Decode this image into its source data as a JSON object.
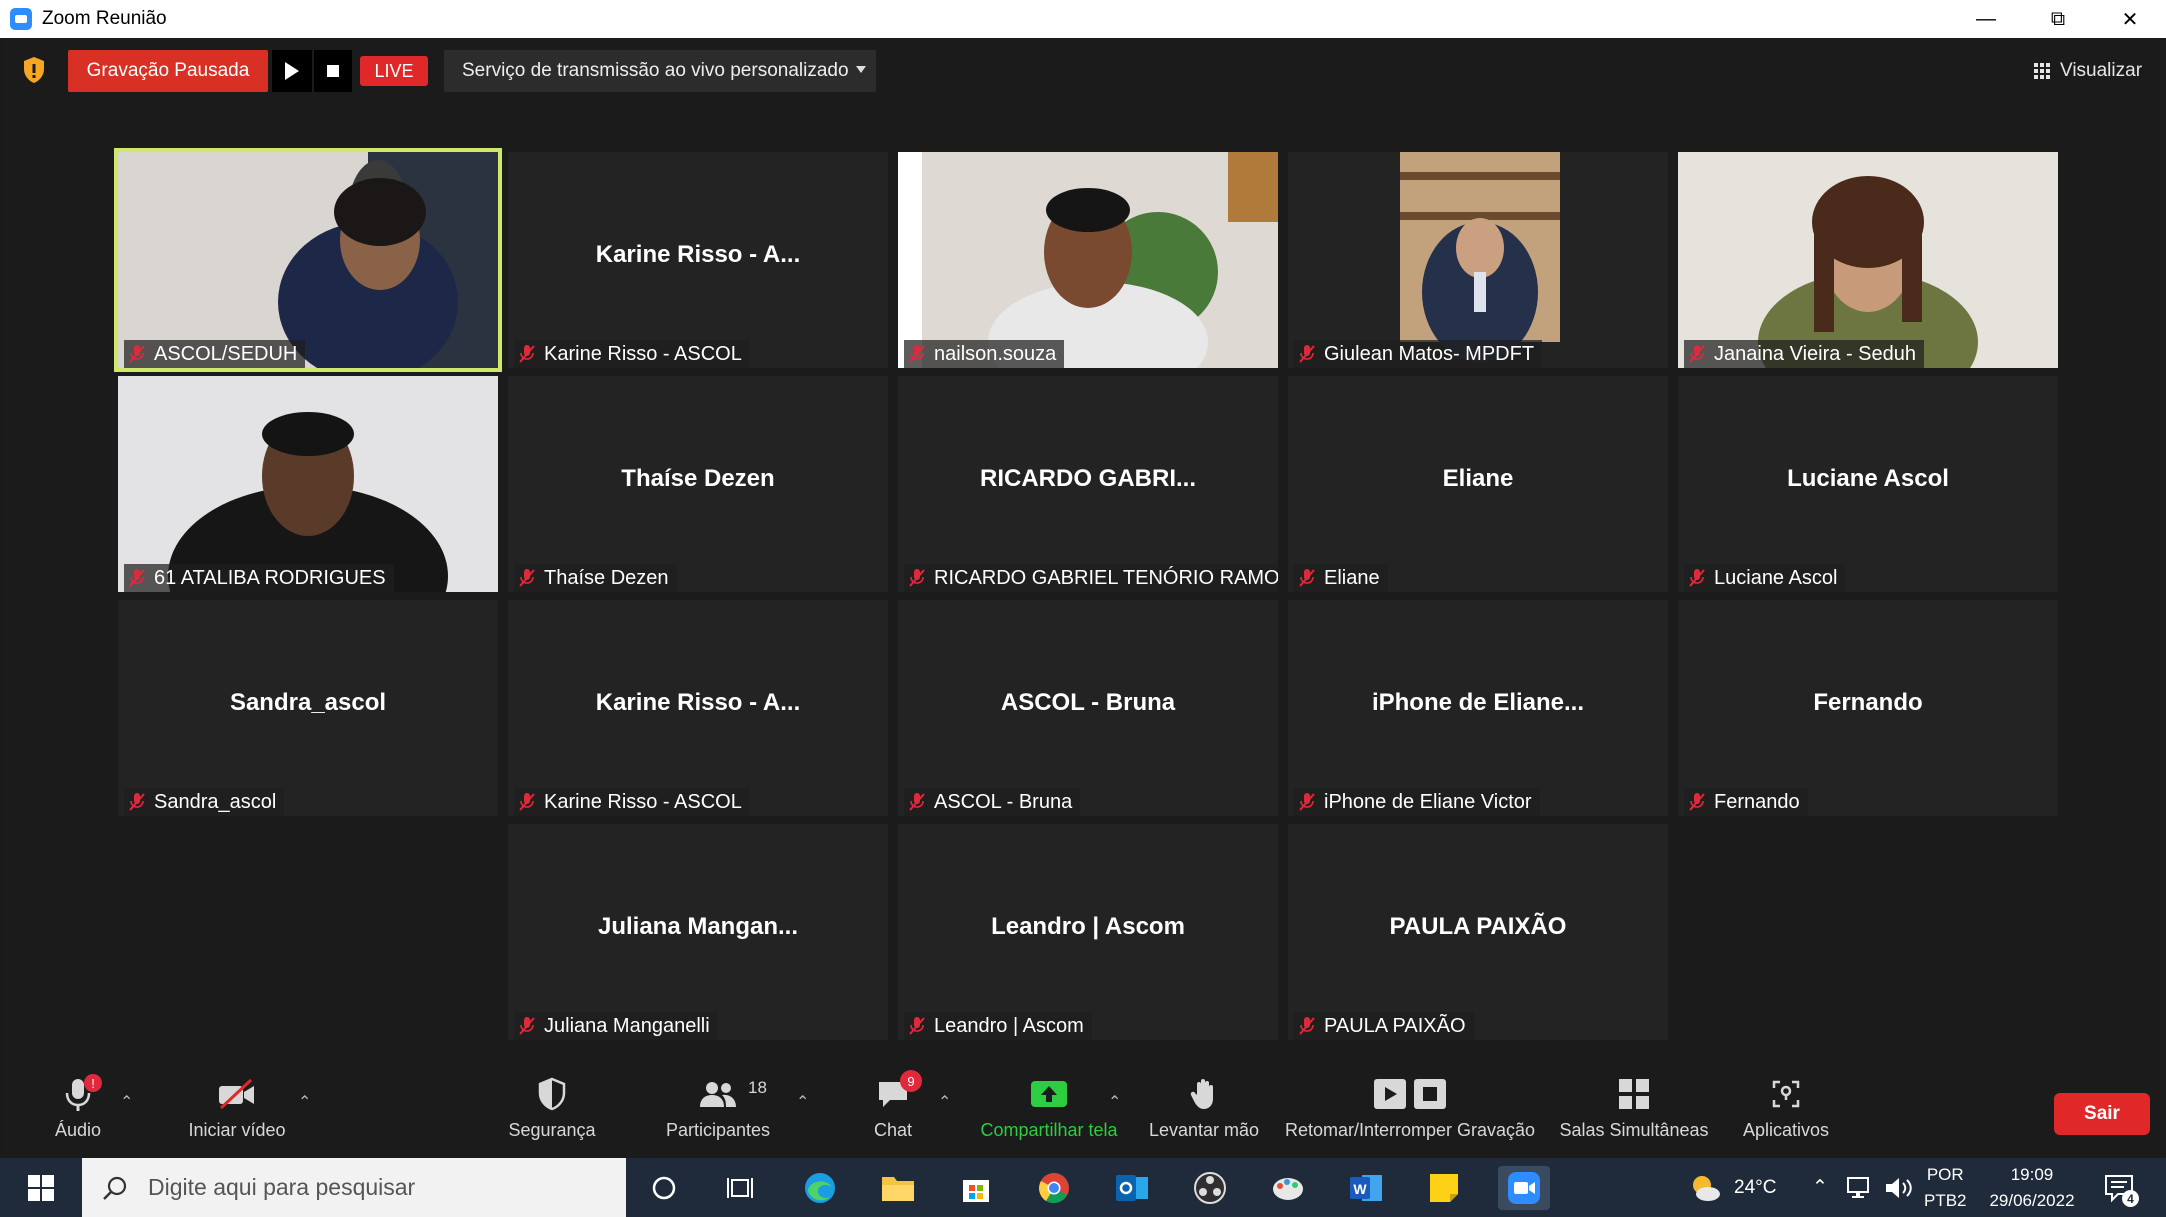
{
  "window": {
    "title": "Zoom Reunião"
  },
  "topbar": {
    "recording_status": "Gravação Pausada",
    "live_badge": "LIVE",
    "stream_service": "Serviço de transmissão ao vivo personalizado",
    "view_label": "Visualizar"
  },
  "tiles": [
    {
      "center": "",
      "label": "ASCOL/SEDUH",
      "video": true
    },
    {
      "center": "Karine Risso - A...",
      "label": "Karine Risso - ASCOL",
      "video": false
    },
    {
      "center": "",
      "label": "nailson.souza",
      "video": true
    },
    {
      "center": "",
      "label": "Giulean Matos- MPDFT",
      "video": true
    },
    {
      "center": "",
      "label": "Janaina Vieira - Seduh",
      "video": true
    },
    {
      "center": "",
      "label": "61 ATALIBA RODRIGUES",
      "video": true
    },
    {
      "center": "Thaíse Dezen",
      "label": "Thaíse Dezen",
      "video": false
    },
    {
      "center": "RICARDO GABRI...",
      "label": "RICARDO GABRIEL TENÓRIO RAMOS",
      "video": false
    },
    {
      "center": "Eliane",
      "label": "Eliane",
      "video": false
    },
    {
      "center": "Luciane Ascol",
      "label": "Luciane Ascol",
      "video": false
    },
    {
      "center": "Sandra_ascol",
      "label": "Sandra_ascol",
      "video": false
    },
    {
      "center": "Karine Risso - A...",
      "label": "Karine Risso - ASCOL",
      "video": false
    },
    {
      "center": "ASCOL - Bruna",
      "label": "ASCOL - Bruna",
      "video": false
    },
    {
      "center": "iPhone de Eliane...",
      "label": "iPhone de Eliane Victor",
      "video": false
    },
    {
      "center": "Fernando",
      "label": "Fernando",
      "video": false
    },
    {
      "center": "Juliana Mangan...",
      "label": "Juliana Manganelli",
      "video": false
    },
    {
      "center": "Leandro | Ascom",
      "label": "Leandro | Ascom",
      "video": false
    },
    {
      "center": "PAULA PAIXÃO",
      "label": "PAULA PAIXÃO",
      "video": false
    }
  ],
  "toolbar": {
    "audio": "Áudio",
    "audio_badge": "!",
    "video": "Iniciar vídeo",
    "security": "Segurança",
    "participants": "Participantes",
    "participants_count": "18",
    "chat": "Chat",
    "chat_badge": "9",
    "share": "Compartilhar tela",
    "raise_hand": "Levantar mão",
    "recording": "Retomar/Interromper Gravação",
    "breakout": "Salas Simultâneas",
    "apps": "Aplicativos",
    "leave": "Sair"
  },
  "taskbar": {
    "search_placeholder": "Digite aqui para pesquisar",
    "temperature": "24°C",
    "lang_top": "POR",
    "lang_bottom": "PTB2",
    "time": "19:09",
    "date": "29/06/2022",
    "notification_count": "4"
  },
  "colors": {
    "recording_red": "#d93025",
    "active_speaker": "#cfe86b",
    "share_green": "#2ecc40",
    "taskbar": "#1f2b3a"
  }
}
